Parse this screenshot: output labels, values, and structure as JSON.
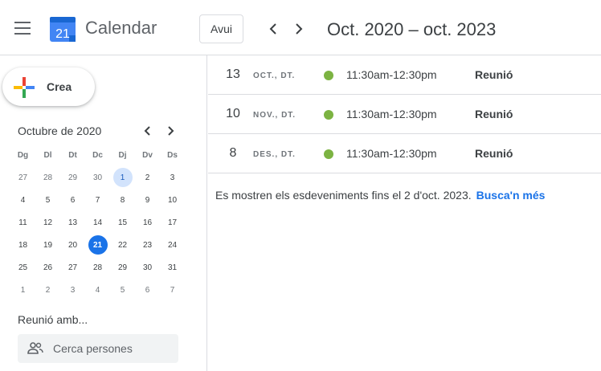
{
  "header": {
    "app_title": "Calendar",
    "logo_day": "21",
    "today_label": "Avui",
    "date_range": "Oct. 2020 – oct. 2023",
    "logo_color": "#4285f4"
  },
  "sidebar": {
    "create_label": "Crea",
    "mini_calendar": {
      "title": "Octubre de 2020",
      "weekdays": [
        "Dg",
        "Dl",
        "Dt",
        "Dc",
        "Dj",
        "Dv",
        "Ds"
      ],
      "weeks": [
        [
          "27",
          "28",
          "29",
          "30",
          "1",
          "2",
          "3"
        ],
        [
          "4",
          "5",
          "6",
          "7",
          "8",
          "9",
          "10"
        ],
        [
          "11",
          "12",
          "13",
          "14",
          "15",
          "16",
          "17"
        ],
        [
          "18",
          "19",
          "20",
          "21",
          "22",
          "23",
          "24"
        ],
        [
          "25",
          "26",
          "27",
          "28",
          "29",
          "30",
          "31"
        ],
        [
          "1",
          "2",
          "3",
          "4",
          "5",
          "6",
          "7"
        ]
      ],
      "selected_day": "1",
      "today_day": "21"
    },
    "meet_title": "Reunió amb...",
    "search_placeholder": "Cerca persones"
  },
  "events": [
    {
      "day": "13",
      "month": "OCT., DT.",
      "time": "11:30am-12:30pm",
      "title": "Reunió",
      "color": "#7cb342"
    },
    {
      "day": "10",
      "month": "NOV., DT.",
      "time": "11:30am-12:30pm",
      "title": "Reunió",
      "color": "#7cb342"
    },
    {
      "day": "8",
      "month": "DES., DT.",
      "time": "11:30am-12:30pm",
      "title": "Reunió",
      "color": "#7cb342"
    }
  ],
  "footer": {
    "note": "Es mostren els esdeveniments fins el 2 d'oct. 2023.",
    "link": "Busca'n més"
  },
  "colors": {
    "accent": "#1a73e8",
    "selected_bg": "#d2e3fc",
    "event_dot": "#7cb342"
  }
}
